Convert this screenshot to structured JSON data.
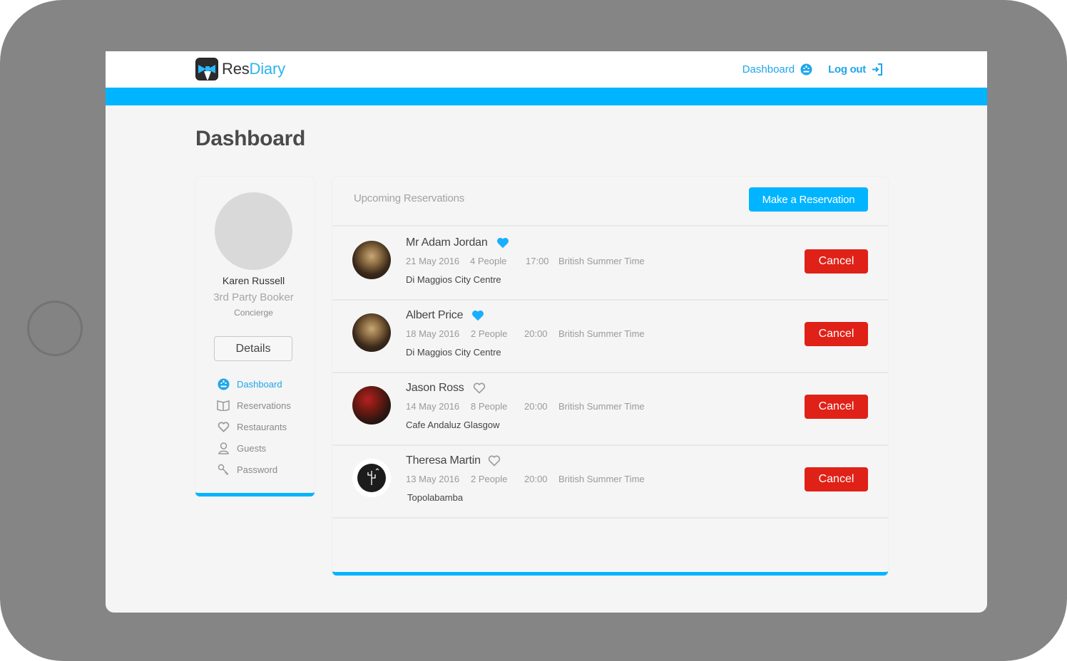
{
  "app": {
    "logo_res": "Res",
    "logo_diary": "Diary",
    "accent_color": "#00b4ff",
    "danger_color": "#e02117"
  },
  "header": {
    "dashboard_link": "Dashboard",
    "dashboard_icon": "dashboard-face-icon",
    "logout_link": "Log out",
    "logout_icon": "logout-arrow-icon"
  },
  "page": {
    "title": "Dashboard"
  },
  "profile": {
    "name": "Karen Russell",
    "role": "3rd Party Booker",
    "subtitle": "Concierge",
    "details_button": "Details"
  },
  "sidebar": {
    "items": [
      {
        "label": "Dashboard",
        "icon": "dashboard-face-icon",
        "active": true
      },
      {
        "label": "Reservations",
        "icon": "book-icon",
        "active": false
      },
      {
        "label": "Restaurants",
        "icon": "heart-icon",
        "active": false
      },
      {
        "label": "Guests",
        "icon": "user-icon",
        "active": false
      },
      {
        "label": "Password",
        "icon": "key-icon",
        "active": false
      }
    ]
  },
  "reservations": {
    "title": "Upcoming Reservations",
    "make_button": "Make a Reservation",
    "cancel_label": "Cancel",
    "rows": [
      {
        "guest": "Mr Adam Jordan",
        "favourite": true,
        "date": "21 May 2016",
        "people": "4 People",
        "time": "17:00",
        "timezone": "British Summer Time",
        "venue": "Di Maggios City Centre"
      },
      {
        "guest": "Albert Price",
        "favourite": true,
        "date": "18 May 2016",
        "people": "2 People",
        "time": "20:00",
        "timezone": "British Summer Time",
        "venue": "Di Maggios City Centre"
      },
      {
        "guest": "Jason Ross",
        "favourite": false,
        "date": "14 May 2016",
        "people": "8 People",
        "time": "20:00",
        "timezone": "British Summer Time",
        "venue": "Cafe Andaluz Glasgow"
      },
      {
        "guest": "Theresa Martin",
        "favourite": false,
        "date": "13 May 2016",
        "people": "2 People",
        "time": "20:00",
        "timezone": "British Summer Time",
        "venue": "Topolabamba"
      }
    ]
  }
}
